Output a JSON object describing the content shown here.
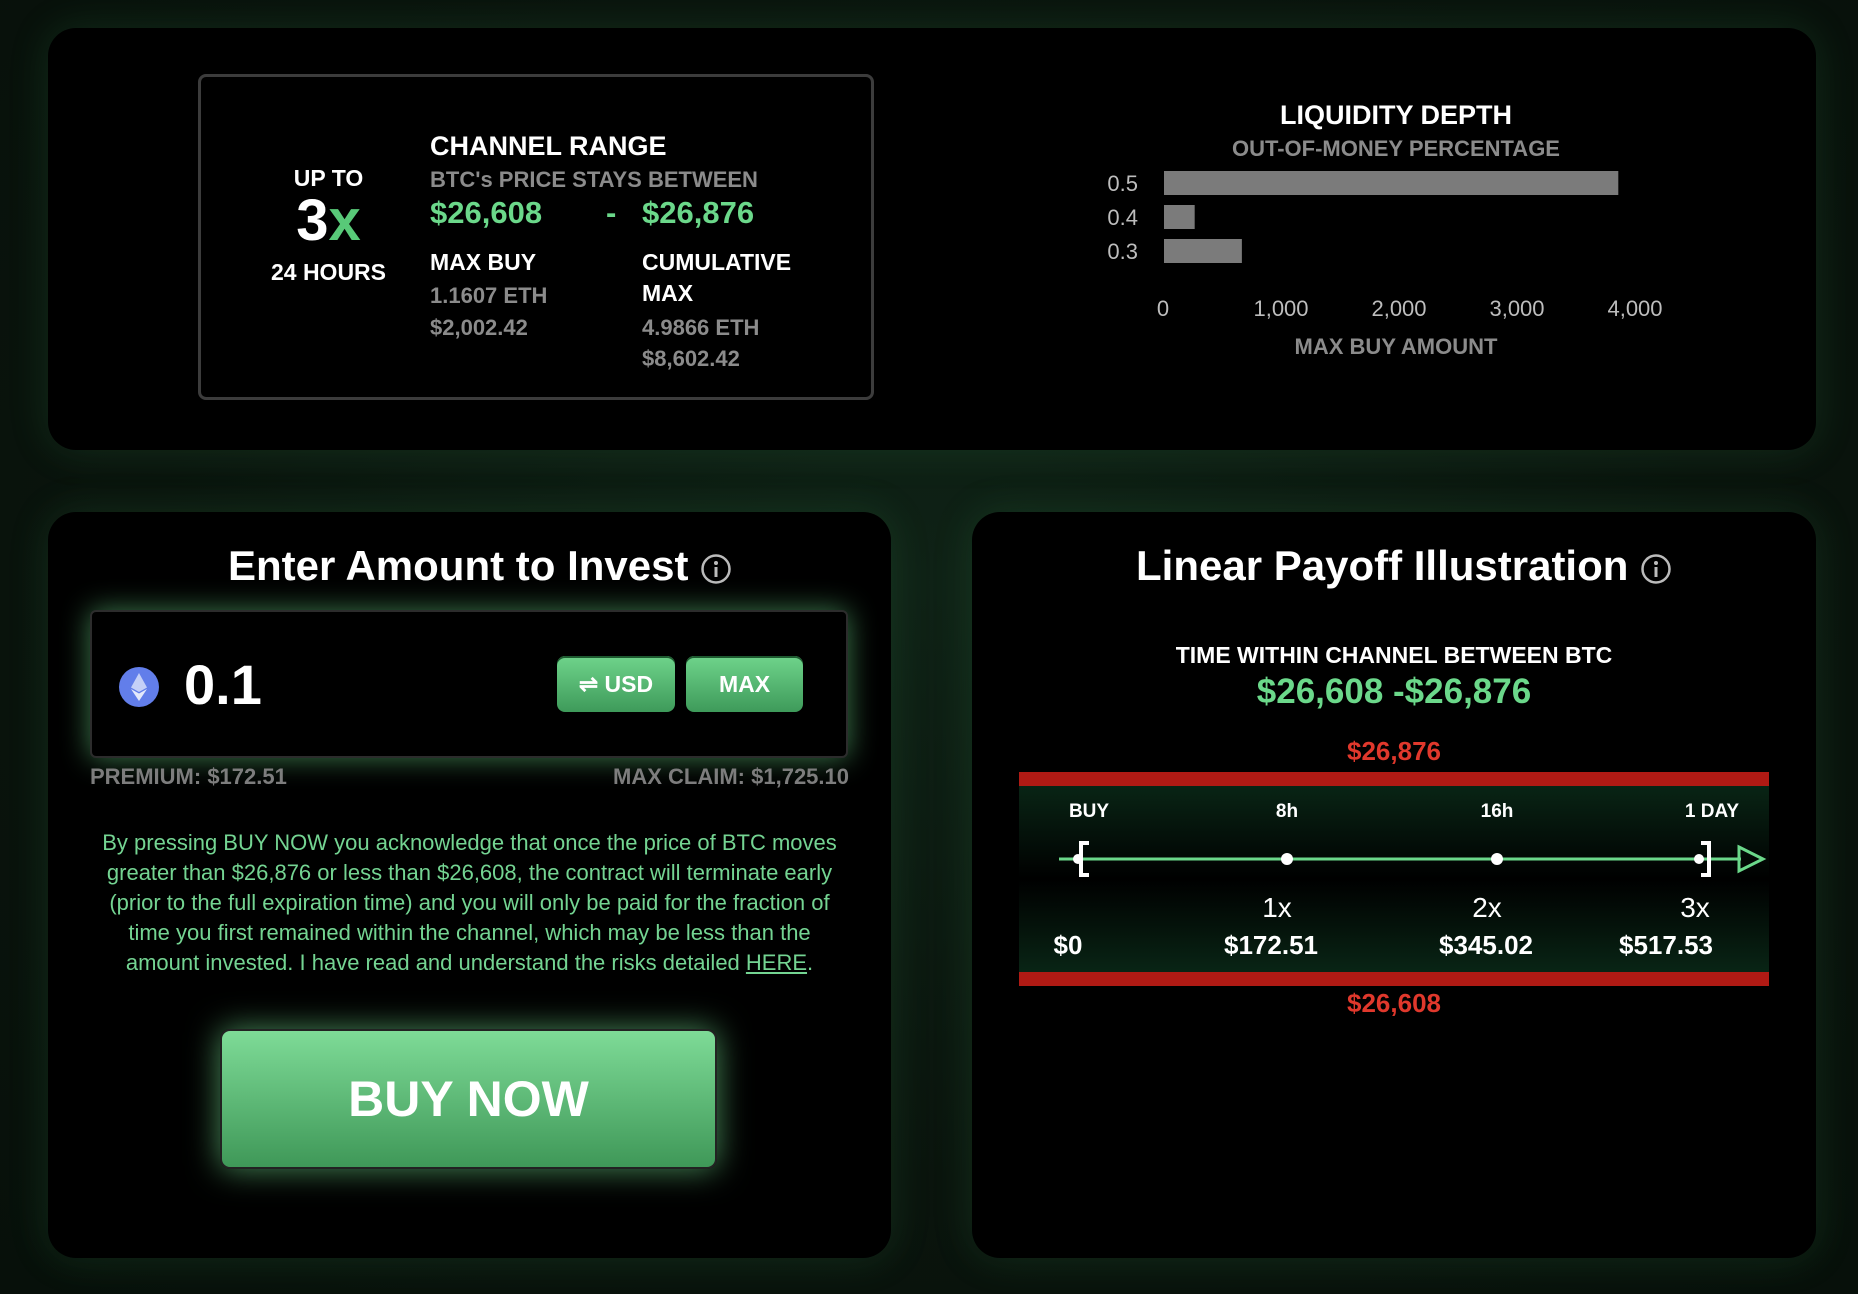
{
  "channel": {
    "up_to": "UP TO",
    "multiplier": "3",
    "multiplier_suffix": "x",
    "duration": "24 HOURS",
    "title": "CHANNEL RANGE",
    "subtitle": "BTC's PRICE STAYS BETWEEN",
    "low": "$26,608",
    "dash": "-",
    "high": "$26,876",
    "max_buy_label": "MAX BUY",
    "max_buy_eth": "1.1607 ETH",
    "max_buy_usd": "$2,002.42",
    "cum_max_label_1": "CUMULATIVE",
    "cum_max_label_2": "MAX",
    "cum_max_eth": "4.9866 ETH",
    "cum_max_usd": "$8,602.42"
  },
  "chart_data": {
    "type": "bar",
    "orientation": "horizontal",
    "title": "LIQUIDITY DEPTH",
    "subtitle": "OUT-OF-MONEY PERCENTAGE",
    "xlabel": "MAX BUY AMOUNT",
    "categories": [
      "0.5",
      "0.4",
      "0.3"
    ],
    "values": [
      3850,
      260,
      660
    ],
    "xlim": [
      0,
      4000
    ],
    "xticks": [
      "0",
      "1,000",
      "2,000",
      "3,000",
      "4,000"
    ],
    "xtick_values": [
      0,
      1000,
      2000,
      3000,
      4000
    ],
    "bar_color": "#7b7b7b",
    "grid": false
  },
  "invest": {
    "title": "Enter Amount to Invest",
    "amount": "0.1",
    "currency_icon": "ethereum-icon",
    "usd_button": "USD",
    "max_button": "MAX",
    "premium": "PREMIUM: $172.51",
    "max_claim": "MAX CLAIM: $1,725.10",
    "disclaimer_lines": [
      "By pressing BUY NOW you acknowledge that once the price of BTC moves",
      "greater than $26,876 or less than $26,608, the contract will terminate early",
      "(prior to the full expiration time) and you will only be paid for the fraction of",
      "time you first remained within the channel, which may be less than the",
      "amount invested. I have read and understand the risks detailed "
    ],
    "disclaimer_link": "HERE",
    "disclaimer_end": ".",
    "buy_button": "BUY NOW"
  },
  "payoff": {
    "title": "Linear Payoff Illustration",
    "subtitle": "TIME WITHIN CHANNEL BETWEEN BTC",
    "range": "$26,608 -$26,876",
    "upper": "$26,876",
    "lower": "$26,608",
    "ticks": [
      "BUY",
      "8h",
      "16h",
      "1 DAY"
    ],
    "multipliers": [
      "1x",
      "2x",
      "3x"
    ],
    "payouts": [
      "$0",
      "$172.51",
      "$345.02",
      "$517.53"
    ]
  },
  "colors": {
    "accent": "#6bd88a",
    "danger": "#e0382c",
    "band_red": "#b01a14",
    "muted": "#8b8b8b"
  }
}
